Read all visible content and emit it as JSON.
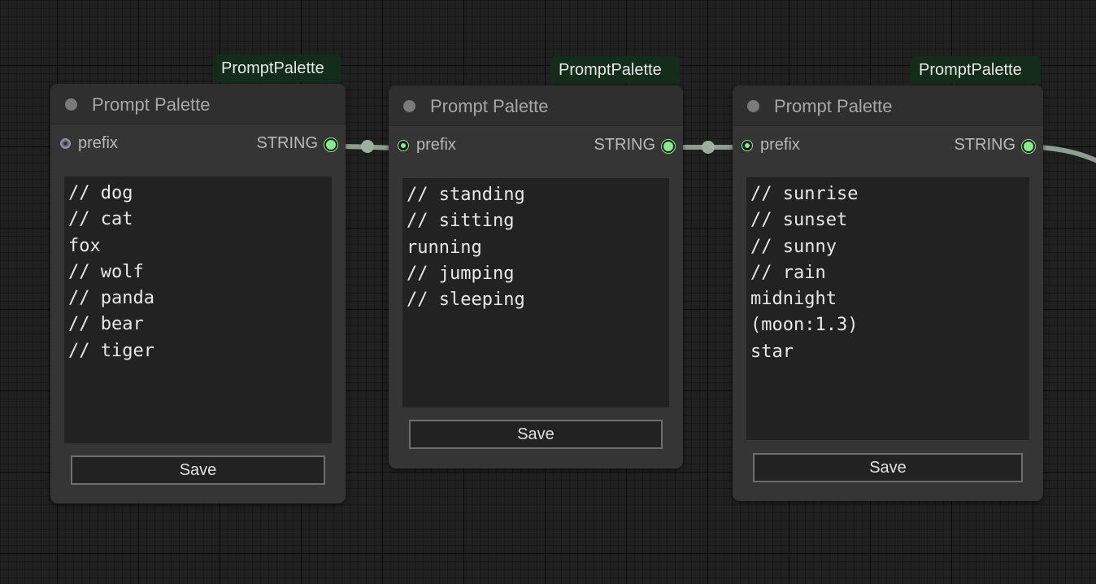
{
  "colors": {
    "canvas_bg": "#202020",
    "node_bg": "#353535",
    "badge_bg": "#142c1a",
    "slot_connected": "#89e98d",
    "link": "#9db09e"
  },
  "nodes": [
    {
      "badge": "PromptPalette",
      "title": "Prompt Palette",
      "input_label": "prefix",
      "output_label": "STRING",
      "lines": [
        "// dog",
        "// cat",
        "fox",
        "// wolf",
        "// panda",
        "// bear",
        "// tiger"
      ],
      "save_label": "Save"
    },
    {
      "badge": "PromptPalette",
      "title": "Prompt Palette",
      "input_label": "prefix",
      "output_label": "STRING",
      "lines": [
        "// standing",
        "// sitting",
        "running",
        "// jumping",
        "// sleeping"
      ],
      "save_label": "Save"
    },
    {
      "badge": "PromptPalette",
      "title": "Prompt Palette",
      "input_label": "prefix",
      "output_label": "STRING",
      "lines": [
        "// sunrise",
        "// sunset",
        "// sunny",
        "// rain",
        "midnight",
        "(moon:1.3)",
        "star"
      ],
      "save_label": "Save"
    }
  ]
}
